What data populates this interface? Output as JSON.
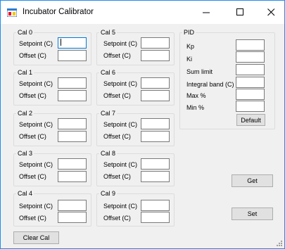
{
  "window": {
    "title": "Incubator Calibrator"
  },
  "cal_groups": [
    {
      "title": "Cal 0",
      "setpoint_label": "Setpoint (C)",
      "offset_label": "Offset (C)",
      "setpoint_value": "",
      "offset_value": ""
    },
    {
      "title": "Cal 1",
      "setpoint_label": "Setpoint (C)",
      "offset_label": "Offset (C)",
      "setpoint_value": "",
      "offset_value": ""
    },
    {
      "title": "Cal 2",
      "setpoint_label": "Setpoint (C)",
      "offset_label": "Offset (C)",
      "setpoint_value": "",
      "offset_value": ""
    },
    {
      "title": "Cal 3",
      "setpoint_label": "Setpoint (C)",
      "offset_label": "Offset (C)",
      "setpoint_value": "",
      "offset_value": ""
    },
    {
      "title": "Cal 4",
      "setpoint_label": "Setpoint (C)",
      "offset_label": "Offset (C)",
      "setpoint_value": "",
      "offset_value": ""
    },
    {
      "title": "Cal 5",
      "setpoint_label": "Setpoint (C)",
      "offset_label": "Offset (C)",
      "setpoint_value": "",
      "offset_value": ""
    },
    {
      "title": "Cal 6",
      "setpoint_label": "Setpoint (C)",
      "offset_label": "Offset (C)",
      "setpoint_value": "",
      "offset_value": ""
    },
    {
      "title": "Cal 7",
      "setpoint_label": "Setpoint (C)",
      "offset_label": "Offset (C)",
      "setpoint_value": "",
      "offset_value": ""
    },
    {
      "title": "Cal 8",
      "setpoint_label": "Setpoint (C)",
      "offset_label": "Offset (C)",
      "setpoint_value": "",
      "offset_value": ""
    },
    {
      "title": "Cal 9",
      "setpoint_label": "Setpoint (C)",
      "offset_label": "Offset (C)",
      "setpoint_value": "",
      "offset_value": ""
    }
  ],
  "pid": {
    "title": "PID",
    "fields": [
      {
        "label": "Kp",
        "value": ""
      },
      {
        "label": "Ki",
        "value": ""
      },
      {
        "label": "Sum limit",
        "value": ""
      },
      {
        "label": "Integral band (C)",
        "value": ""
      },
      {
        "label": "Max %",
        "value": ""
      },
      {
        "label": "Min %",
        "value": ""
      }
    ],
    "default_label": "Default"
  },
  "buttons": {
    "get_label": "Get",
    "set_label": "Set",
    "clear_cal_label": "Clear Cal"
  },
  "icons": {
    "app": "app-window-icon",
    "minimize": "minimize-icon",
    "maximize": "maximize-icon",
    "close": "close-icon",
    "grip": "resize-grip-icon"
  },
  "colors": {
    "window_border": "#1e8ff0",
    "focus_border": "#0078d7",
    "form_background": "#f0f0f0"
  }
}
